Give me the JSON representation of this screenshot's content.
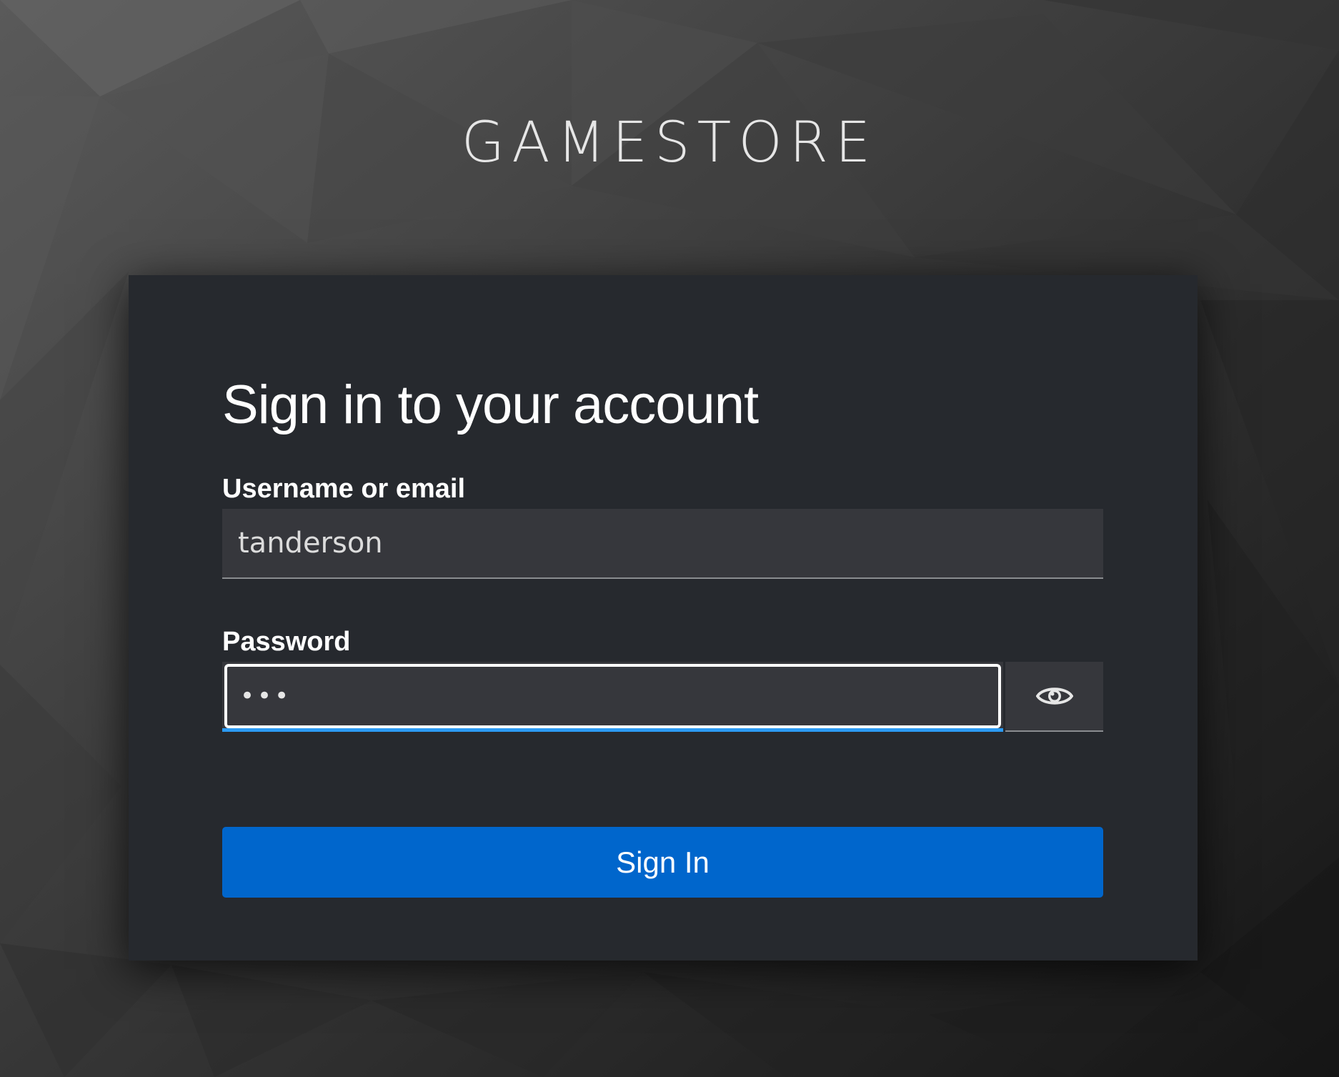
{
  "brand": {
    "title": "GAMESTORE"
  },
  "login": {
    "heading": "Sign in to your account",
    "username_label": "Username or email",
    "username_value": "tanderson",
    "password_label": "Password",
    "password_value": "•••",
    "toggle_icon": "eye-icon",
    "submit_label": "Sign In"
  },
  "colors": {
    "card_background": "#26292e",
    "input_background": "#36373c",
    "primary_button": "#0066cc",
    "focus_underline": "#2b9af3",
    "text": "#ffffff"
  }
}
